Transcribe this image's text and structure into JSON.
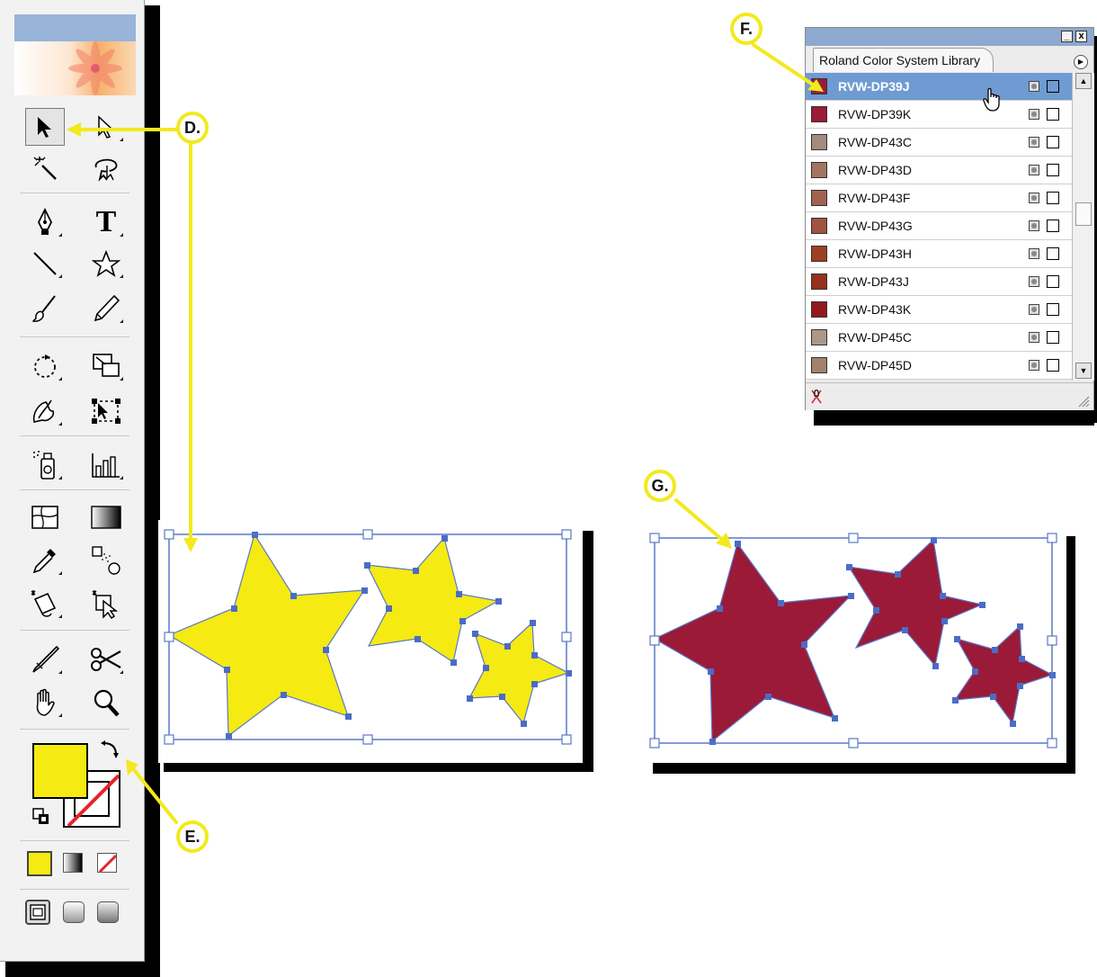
{
  "callouts": {
    "d": "D.",
    "e": "E.",
    "f": "F.",
    "g": "G."
  },
  "toolbox": {
    "tools": [
      {
        "name": "selection-tool-icon",
        "selected": true
      },
      {
        "name": "direct-selection-tool-icon"
      },
      {
        "name": "magic-wand-tool-icon"
      },
      {
        "name": "lasso-tool-icon"
      },
      {
        "name": "pen-tool-icon"
      },
      {
        "name": "type-tool-icon",
        "glyph": "T"
      },
      {
        "name": "line-segment-tool-icon"
      },
      {
        "name": "star-tool-icon"
      },
      {
        "name": "paintbrush-tool-icon"
      },
      {
        "name": "pencil-tool-icon"
      },
      {
        "name": "rotate-tool-icon"
      },
      {
        "name": "scale-tool-icon"
      },
      {
        "name": "warp-tool-icon"
      },
      {
        "name": "free-transform-tool-icon"
      },
      {
        "name": "symbol-sprayer-tool-icon"
      },
      {
        "name": "column-graph-tool-icon"
      },
      {
        "name": "mesh-tool-icon"
      },
      {
        "name": "gradient-tool-icon"
      },
      {
        "name": "eyedropper-tool-icon"
      },
      {
        "name": "blend-tool-icon"
      },
      {
        "name": "live-paint-bucket-tool-icon"
      },
      {
        "name": "live-paint-selection-tool-icon"
      },
      {
        "name": "slice-tool-icon"
      },
      {
        "name": "scissors-tool-icon"
      },
      {
        "name": "hand-tool-icon"
      },
      {
        "name": "zoom-tool-icon"
      }
    ],
    "fill_color": "#f5ea12",
    "stroke": "none"
  },
  "swatch_panel": {
    "tab_title": "Roland Color System Library",
    "minimize_glyph": "_",
    "close_glyph": "x",
    "swatches": [
      {
        "name": "RVW-DP39J",
        "color": "#9b1a38",
        "selected": true
      },
      {
        "name": "RVW-DP39K",
        "color": "#9b1a38"
      },
      {
        "name": "RVW-DP43C",
        "color": "#a58a7e"
      },
      {
        "name": "RVW-DP43D",
        "color": "#a27462"
      },
      {
        "name": "RVW-DP43F",
        "color": "#a16350"
      },
      {
        "name": "RVW-DP43G",
        "color": "#a0533f"
      },
      {
        "name": "RVW-DP43H",
        "color": "#9c3f22"
      },
      {
        "name": "RVW-DP43J",
        "color": "#97301c"
      },
      {
        "name": "RVW-DP43K",
        "color": "#93191c"
      },
      {
        "name": "RVW-DP45C",
        "color": "#ab9888"
      },
      {
        "name": "RVW-DP45D",
        "color": "#a3826c"
      }
    ]
  },
  "artwork": {
    "left_fill": "#f5ea12",
    "right_fill": "#9b1a38",
    "selection_color": "#5a78c8"
  }
}
